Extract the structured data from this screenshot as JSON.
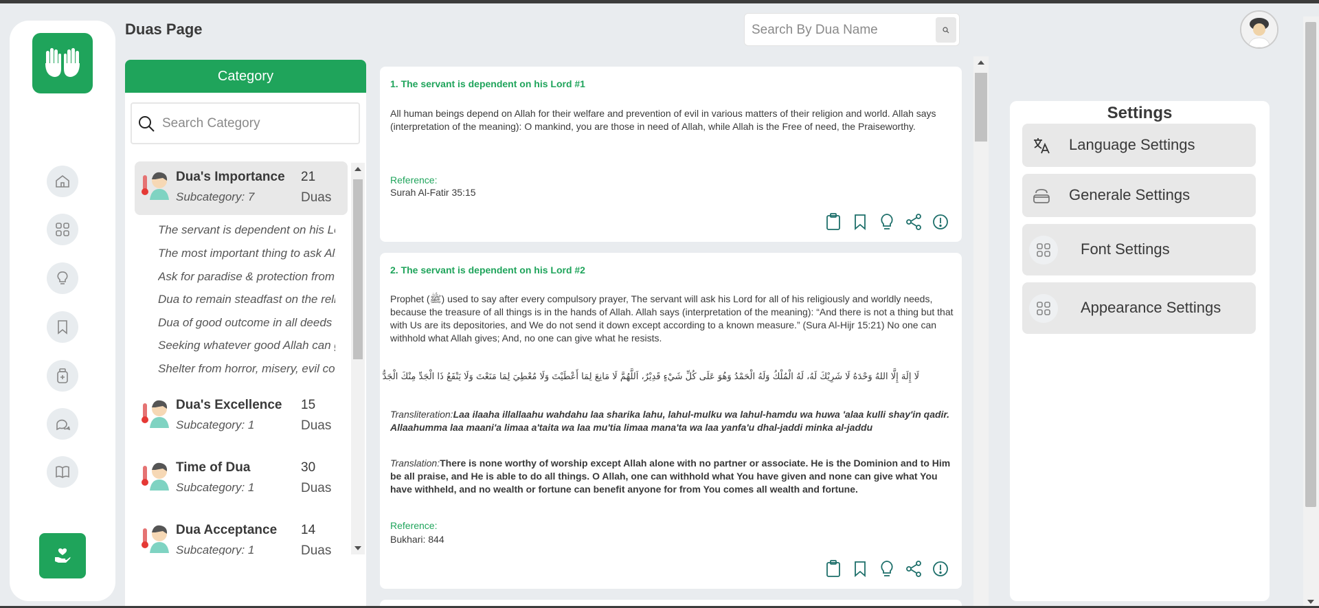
{
  "header": {
    "page_title": "Duas Page",
    "search_placeholder": "Search By Dua Name"
  },
  "sidebar": {
    "logo_icon": "praying-hands-icon",
    "nav_icons": [
      "home-icon",
      "grid-icon",
      "lightbulb-icon",
      "bookmark-icon",
      "medicine-bottle-icon",
      "chat-icon",
      "book-icon"
    ],
    "support_icon": "hand-heart-icon"
  },
  "category": {
    "header": "Category",
    "search_placeholder": "Search Category",
    "items": [
      {
        "name": "Dua's Importance",
        "subcategory": "Subcategory: 7",
        "count": "21",
        "unit": "Duas",
        "subitems": [
          "The servant is dependent on his Lord",
          "The most important thing to ask Allah for",
          "Ask for paradise & protection from fire",
          "Dua to remain steadfast on the religion",
          "Dua of good outcome in all deeds",
          "Seeking whatever good Allah can give",
          "Shelter from horror, misery, evil consequences"
        ]
      },
      {
        "name": "Dua's Excellence",
        "subcategory": "Subcategory: 1",
        "count": "15",
        "unit": "Duas"
      },
      {
        "name": "Time of Dua",
        "subcategory": "Subcategory: 1",
        "count": "30",
        "unit": "Duas"
      },
      {
        "name": "Dua Acceptance",
        "subcategory": "Subcategory: 1",
        "count": "14",
        "unit": "Duas"
      }
    ]
  },
  "duas": [
    {
      "title": "1. The servant is dependent on his Lord #1",
      "body": "All human beings depend on Allah for their welfare and prevention of evil in various matters of their religion and world. Allah says (interpretation of the meaning): O mankind, you are those in need of Allah, while Allah is the Free of need, the Praiseworthy.",
      "reference_label": "Reference:",
      "reference": "Surah Al-Fatir 35:15"
    },
    {
      "title": "2. The servant is dependent on his Lord #2",
      "body": "Prophet (ﷺ) used to say after every compulsory prayer, The servant will ask his Lord for all of his religiously and worldly needs, because the treasure of all things is in the hands of Allah. Allah says (interpretation of the meaning): “And there is not a thing but that with Us are its depositories, and We do not send it down except according to a known measure.” (Sura Al-Hijr 15:21) No one can withhold what Allah gives; And, no one can give what he resists.",
      "arabic": "لَا إِلَهَ إِلَّا اللهُ وَحْدَهُ لَا شَرِيْكَ لَهُ، لَهُ الْمُلْكُ وَلَهُ الْحَمْدُ وَهُوَ عَلَى كُلِّ شَيْءٍ قَدِيْرٌ، اَللَّهُمَّ لَا مَانِعَ لِمَا أَعْطَيْتَ وَلَا مُعْطِيَ لِمَا مَنَعْتَ وَلَا يَنْفَعُ ذَا الْجَدِّ مِنْكَ الْجَدُّ",
      "transliteration_label": "Transliteration:",
      "transliteration": "Laa ilaaha illallaahu wahdahu laa sharika lahu, lahul-mulku wa lahul-hamdu wa huwa 'alaa kulli shay'in qadir. Allaahumma laa maani'a limaa a'taita wa laa mu'tia limaa mana'ta wa laa yanfa'u dhal-jaddi minka al-jaddu",
      "translation_label": "Translation:",
      "translation": "There is none worthy of worship except Allah alone with no partner or associate. He is the Dominion and to Him be all praise, and He is able to do all things. O Allah, one can withhold what You have given and none can give what You have withheld, and no wealth or fortune can benefit anyone for from You comes all wealth and fortune.",
      "reference_label": "Reference:",
      "reference": "Bukhari: 844"
    }
  ],
  "card_actions": [
    "copy-icon",
    "bookmark-icon",
    "lightbulb-icon",
    "share-icon",
    "report-icon"
  ],
  "settings": {
    "title": "Settings",
    "items": [
      {
        "label": "Language Settings",
        "icon": "translate-icon"
      },
      {
        "label": "Generale Settings",
        "icon": "general-icon"
      },
      {
        "label": "Font Settings",
        "icon": "grid-icon"
      },
      {
        "label": "Appearance Settings",
        "icon": "grid-icon"
      }
    ]
  },
  "colors": {
    "accent": "#1fa45b",
    "background": "#e9ecef"
  }
}
